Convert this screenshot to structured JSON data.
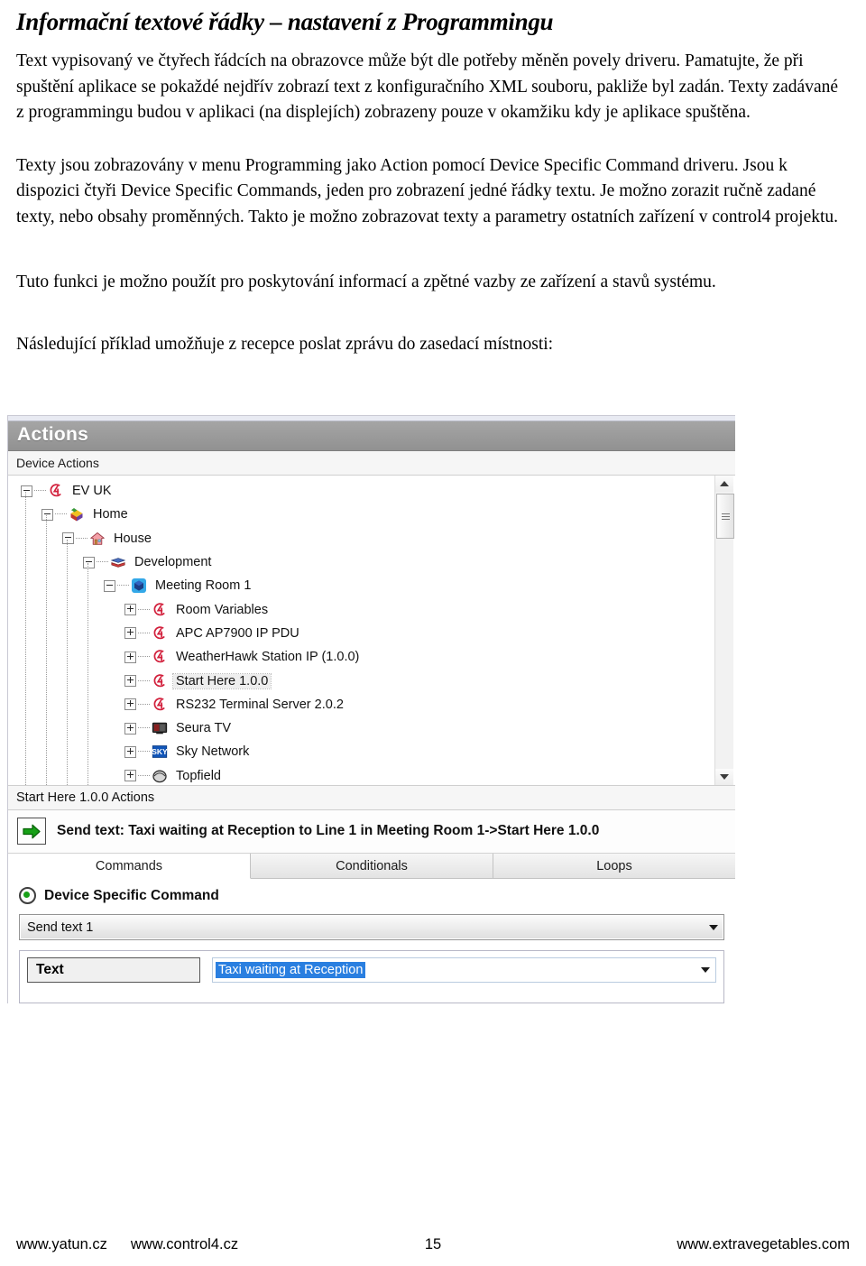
{
  "document": {
    "title": "Informační textové řádky – nastavení z Programmingu",
    "paragraphs": [
      "Text vypisovaný ve čtyřech řádcích na obrazovce může být dle potřeby měněn povely driveru. Pamatujte, že při spuštění aplikace se pokaždé nejdřív zobrazí text z konfiguračního XML souboru, pakliže byl zadán.  Texty zadávané z programmingu budou v aplikaci (na displejích) zobrazeny pouze v okamžiku kdy je aplikace spuštěna.",
      "Texty jsou zobrazovány v menu Programming jako Action  pomocí Device Specific Command driveru.  Jsou k dispozici čtyři Device Specific Commands, jeden pro zobrazení jedné řádky textu. Je možno zorazit ručně zadané texty, nebo obsahy proměnných. Takto je možno zobrazovat texty a parametry ostatních zařízení v control4 projektu.",
      "Tuto funkci je možno použít pro poskytování informací a zpětné vazby ze zařízení a stavů systému.",
      "Následující příklad umožňuje z recepce poslat zprávu do zasedací místnosti:"
    ]
  },
  "screenshot": {
    "panel_title": "Actions",
    "tree_header": "Device Actions",
    "tree": [
      {
        "label": "EV UK",
        "depth": 0,
        "expander": "minus",
        "icon": "control4-logo-icon"
      },
      {
        "label": "Home",
        "depth": 1,
        "expander": "minus",
        "icon": "home-folder-icon"
      },
      {
        "label": "House",
        "depth": 2,
        "expander": "minus",
        "icon": "house-icon"
      },
      {
        "label": "Development",
        "depth": 3,
        "expander": "minus",
        "icon": "room-books-icon"
      },
      {
        "label": "Meeting Room 1",
        "depth": 4,
        "expander": "minus",
        "icon": "meeting-room-icon"
      },
      {
        "label": "Room Variables",
        "depth": 5,
        "expander": "plus",
        "icon": "control4-logo-icon"
      },
      {
        "label": "APC AP7900 IP PDU",
        "depth": 5,
        "expander": "plus",
        "icon": "control4-logo-icon"
      },
      {
        "label": "WeatherHawk Station IP (1.0.0)",
        "depth": 5,
        "expander": "plus",
        "icon": "control4-logo-icon"
      },
      {
        "label": "Start Here 1.0.0",
        "depth": 5,
        "expander": "plus",
        "icon": "control4-logo-icon",
        "selected": true
      },
      {
        "label": "RS232 Terminal Server 2.0.2",
        "depth": 5,
        "expander": "plus",
        "icon": "control4-logo-icon"
      },
      {
        "label": "Seura TV",
        "depth": 5,
        "expander": "plus",
        "icon": "tv-icon"
      },
      {
        "label": "Sky Network",
        "depth": 5,
        "expander": "plus",
        "icon": "sky-icon"
      },
      {
        "label": "Topfield",
        "depth": 5,
        "expander": "plus",
        "icon": "topfield-icon"
      }
    ],
    "selected_actions_header": "Start Here 1.0.0 Actions",
    "action_row": {
      "icon": "green-arrow-icon",
      "text": "Send text: Taxi waiting at Reception to Line 1 in Meeting Room 1->Start Here 1.0.0"
    },
    "tabs": [
      {
        "label": "Commands",
        "active": true
      },
      {
        "label": "Conditionals",
        "active": false
      },
      {
        "label": "Loops",
        "active": false
      }
    ],
    "command_type_label": "Device Specific Command",
    "command_select_value": "Send text 1",
    "param": {
      "label": "Text",
      "value": "Taxi waiting at Reception"
    },
    "colors": {
      "panel_header_bg": "#9a9a9a",
      "selection_blue": "#2a7fe0",
      "radio_green": "#18a018",
      "arrow_green": "#129c12",
      "control4_red": "#d2203c"
    }
  },
  "footer": {
    "left": "www.yatun.cz",
    "middle": "www.control4.cz",
    "page_number": "15",
    "right": "www.extravegetables.com"
  }
}
